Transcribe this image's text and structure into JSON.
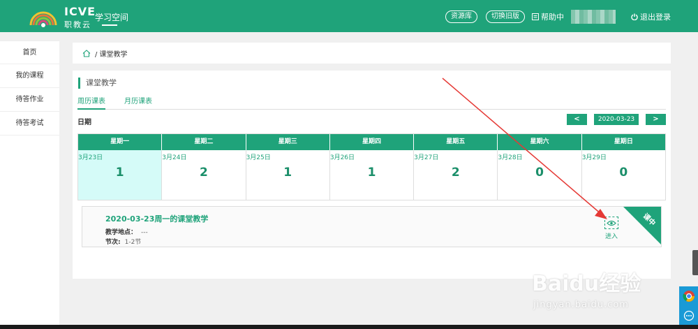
{
  "header": {
    "logo_text": "ICVE",
    "logo_subtitle": "职教云",
    "space_title": "学习空间",
    "resource_label": "资源库",
    "switch_label": "切换旧版",
    "help_label": "帮助中",
    "logout_label": "退出登录"
  },
  "sidebar": {
    "items": [
      {
        "label": "首页"
      },
      {
        "label": "我的课程"
      },
      {
        "label": "待答作业"
      },
      {
        "label": "待答考试"
      }
    ]
  },
  "breadcrumb": {
    "current": "/ 课堂教学"
  },
  "panel": {
    "title": "课堂教学",
    "tabs": [
      {
        "label": "周历课表",
        "active": true
      },
      {
        "label": "月历课表",
        "active": false
      }
    ],
    "date_label": "日期",
    "prev_label": "<",
    "next_label": ">",
    "current_date": "2020-03-23",
    "week": [
      {
        "weekday": "星期一",
        "date": "3月23日",
        "count": "1",
        "selected": true
      },
      {
        "weekday": "星期二",
        "date": "3月24日",
        "count": "2",
        "selected": false
      },
      {
        "weekday": "星期三",
        "date": "3月25日",
        "count": "1",
        "selected": false
      },
      {
        "weekday": "星期四",
        "date": "3月26日",
        "count": "1",
        "selected": false
      },
      {
        "weekday": "星期五",
        "date": "3月27日",
        "count": "2",
        "selected": false
      },
      {
        "weekday": "星期六",
        "date": "3月28日",
        "count": "0",
        "selected": false
      },
      {
        "weekday": "星期日",
        "date": "3月29日",
        "count": "0",
        "selected": false
      }
    ],
    "class_card": {
      "title": "2020-03-23周一的课堂教学",
      "location_label": "教学地点：",
      "location_value": "---",
      "period_label": "节次:",
      "period_value": "1-2节",
      "enter_label": "进入",
      "status_ribbon": "课中"
    }
  },
  "watermark": {
    "text": "Baidu经验",
    "sub": "jingyan.baidu.com"
  },
  "colors": {
    "brand": "#1fa37a",
    "selected_day": "#d5fbf8",
    "arrow": "#e53935"
  },
  "icons": [
    "home-icon",
    "help-icon",
    "power-icon",
    "eye-icon",
    "chrome-icon",
    "chat-icon"
  ]
}
